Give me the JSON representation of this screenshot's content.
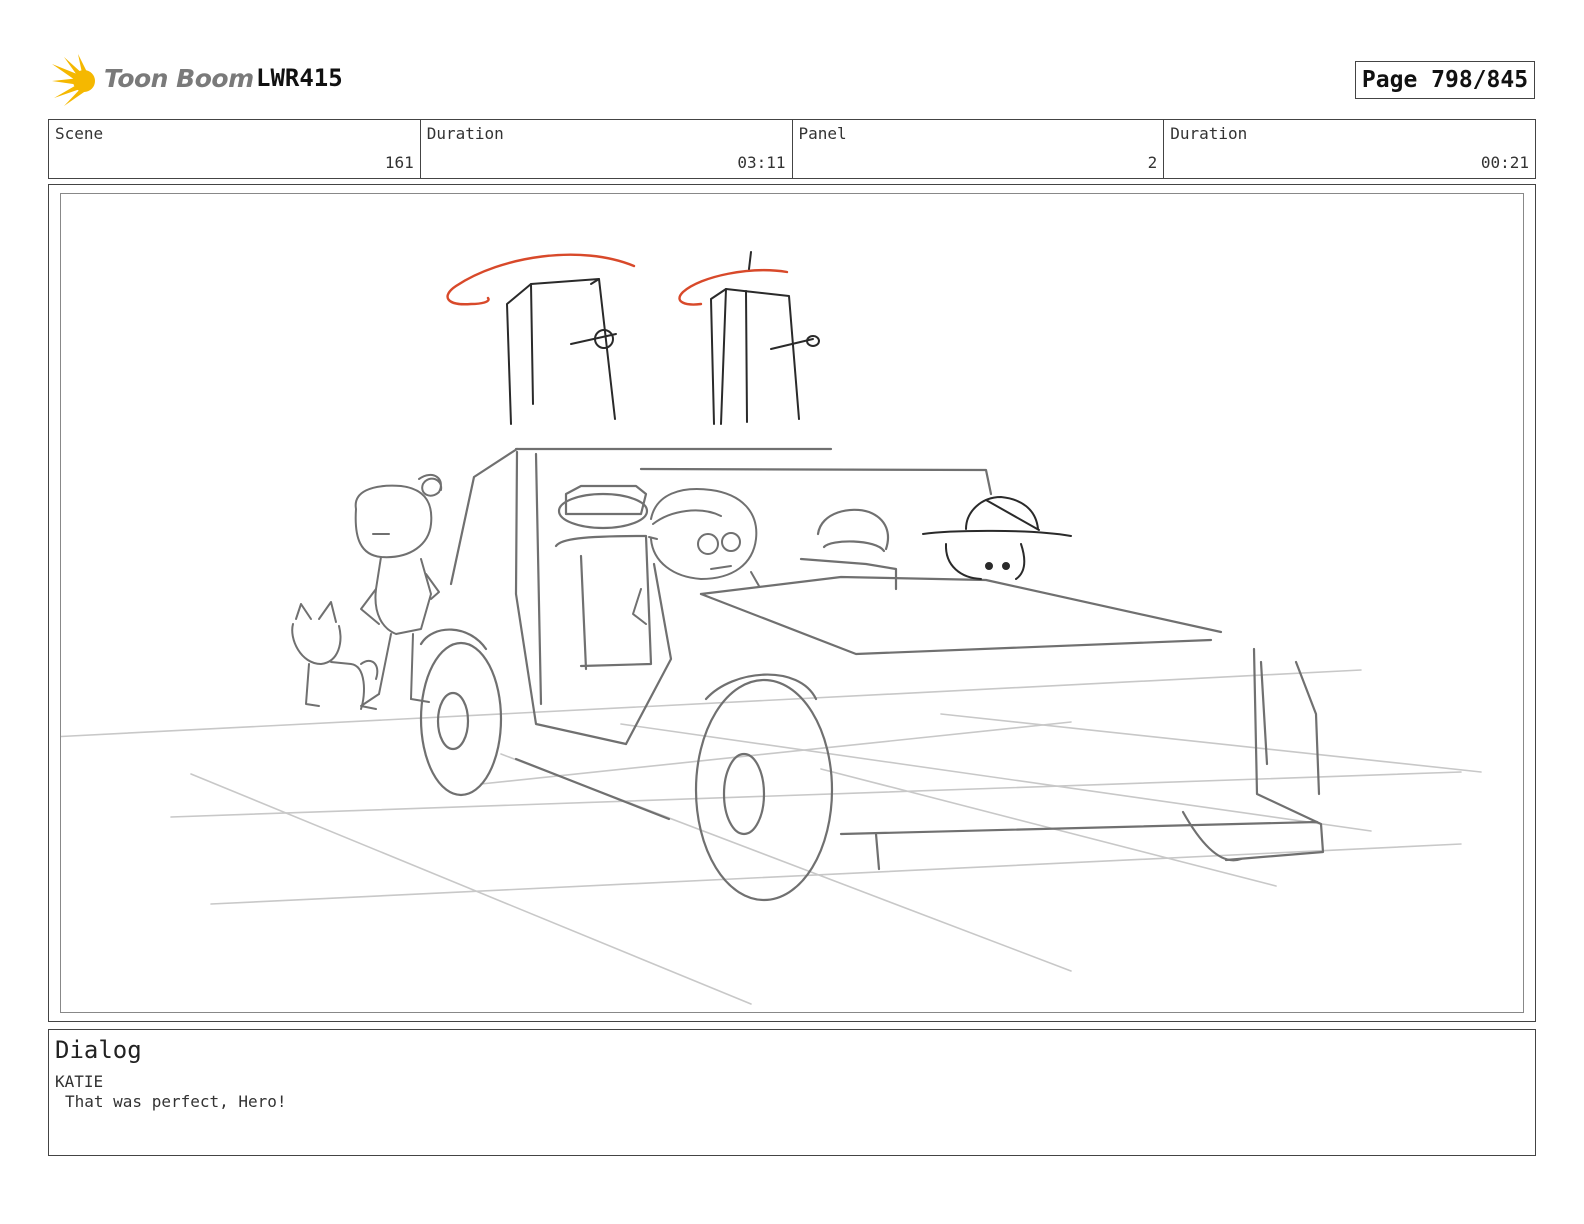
{
  "header": {
    "logo_text": "Toon Boom",
    "project_id": "LWR415",
    "page_label": "Page 798/845"
  },
  "info": {
    "scene_label": "Scene",
    "scene_value": "161",
    "scene_duration_label": "Duration",
    "scene_duration_value": "03:11",
    "panel_label": "Panel",
    "panel_value": "2",
    "panel_duration_label": "Duration",
    "panel_duration_value": "00:21"
  },
  "dialog": {
    "title": "Dialog",
    "speaker": "KATIE",
    "line": "That was perfect, Hero!"
  },
  "colors": {
    "logo_yellow": "#f5b800",
    "sketch_gray": "#707070",
    "sketch_dark": "#2a2a2a",
    "arrow_red": "#d8492a"
  }
}
